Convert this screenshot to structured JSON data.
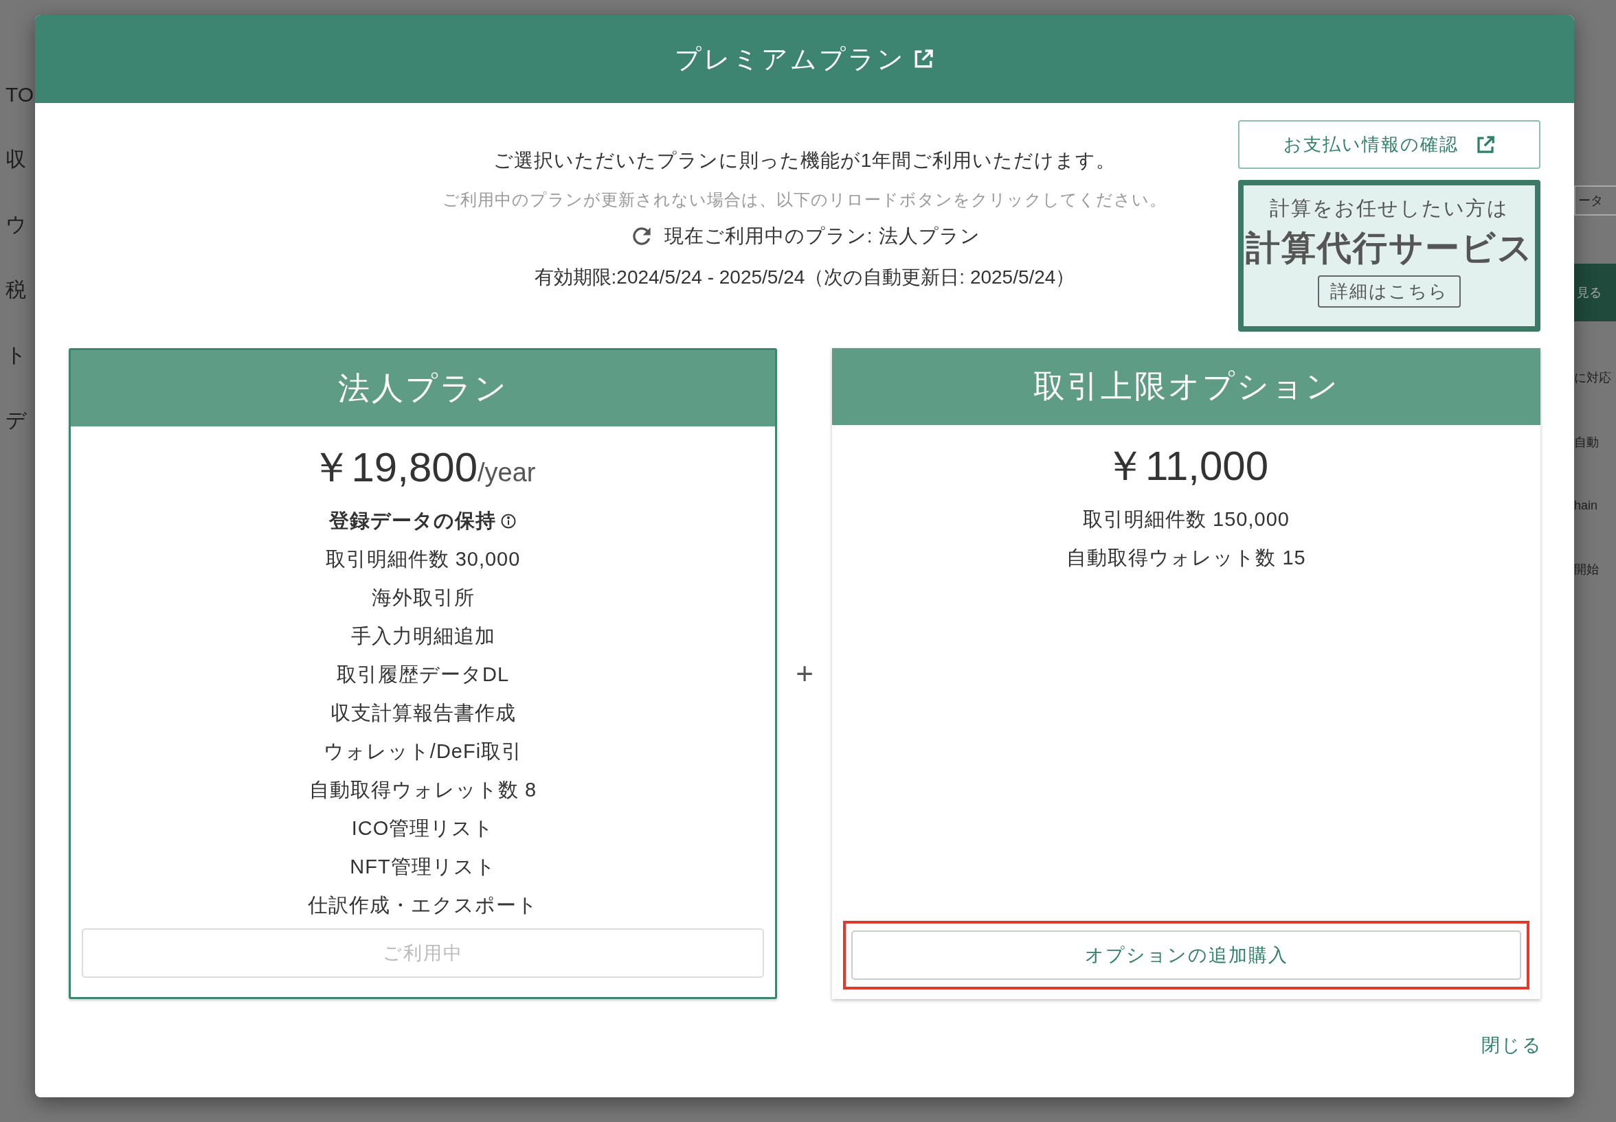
{
  "background": {
    "left_fragments": [
      "TO",
      "収",
      "ウ",
      "税",
      "ト",
      "デ"
    ],
    "right_fragments": [
      {
        "kind": "field",
        "text": "ータ"
      },
      {
        "kind": "button",
        "text": "見る"
      },
      {
        "kind": "text",
        "text": "に対応"
      },
      {
        "kind": "text",
        "text": "自動"
      },
      {
        "kind": "text",
        "text": "hain"
      },
      {
        "kind": "text",
        "text": "開始"
      }
    ]
  },
  "modal": {
    "title": "プレミアムプラン",
    "intro": "ご選択いただいたプランに則った機能が1年間ご利用いただけます。",
    "notice": "ご利用中のプランが更新されない場合は、以下のリロードボタンをクリックしてください。",
    "current_plan": "現在ご利用中のプラン: 法人プラン",
    "validity": "有効期限:2024/5/24 - 2025/5/24（次の自動更新日: 2025/5/24）",
    "payment_button": "お支払い情報の確認",
    "service_promo": {
      "lead": "計算をお任せしたい方は",
      "headline": "計算代行サービス",
      "button": "詳細はこちら"
    },
    "plans": [
      {
        "title": "法人プラン",
        "bordered": true,
        "price": "￥19,800",
        "period": "/year",
        "features": [
          {
            "kind": "heading",
            "text": "登録データの保持"
          },
          {
            "kind": "item",
            "text": "取引明細件数 30,000"
          },
          {
            "kind": "item",
            "text": "海外取引所"
          },
          {
            "kind": "item",
            "text": "手入力明細追加"
          },
          {
            "kind": "item",
            "text": "取引履歴データDL"
          },
          {
            "kind": "item",
            "text": "収支計算報告書作成"
          },
          {
            "kind": "item",
            "text": "ウォレット/DeFi取引"
          },
          {
            "kind": "item",
            "text": "自動取得ウォレット数 8"
          },
          {
            "kind": "item",
            "text": "ICO管理リスト"
          },
          {
            "kind": "item",
            "text": "NFT管理リスト"
          },
          {
            "kind": "item",
            "text": "仕訳作成・エクスポート"
          }
        ],
        "button": {
          "label": "ご利用中",
          "disabled": true,
          "highlighted": false
        }
      },
      {
        "title": "取引上限オプション",
        "bordered": false,
        "price": "￥11,000",
        "features": [
          {
            "kind": "item",
            "text": "取引明細件数 150,000"
          },
          {
            "kind": "item",
            "text": "自動取得ウォレット数 15"
          }
        ],
        "button": {
          "label": "オプションの追加購入",
          "disabled": false,
          "highlighted": true
        }
      }
    ],
    "plus": "+",
    "close": "閉じる"
  }
}
